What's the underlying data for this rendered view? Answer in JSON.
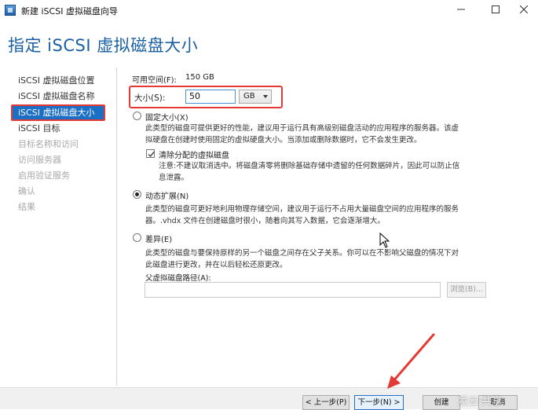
{
  "window": {
    "title": "新建 iSCSI 虚拟磁盘向导"
  },
  "page": {
    "title": "指定 iSCSI 虚拟磁盘大小"
  },
  "nav": {
    "items": [
      {
        "label": "iSCSI 虚拟磁盘位置",
        "state": "normal"
      },
      {
        "label": "iSCSI 虚拟磁盘名称",
        "state": "normal"
      },
      {
        "label": "iSCSI 虚拟磁盘大小",
        "state": "active"
      },
      {
        "label": "iSCSI 目标",
        "state": "normal"
      },
      {
        "label": "目标名称和访问",
        "state": "disabled"
      },
      {
        "label": "访问服务器",
        "state": "disabled"
      },
      {
        "label": "启用验证服务",
        "state": "disabled"
      },
      {
        "label": "确认",
        "state": "disabled"
      },
      {
        "label": "结果",
        "state": "disabled"
      }
    ]
  },
  "form": {
    "free_space_label": "可用空间(F):",
    "free_space_value": "150 GB",
    "size_label": "大小(S):",
    "size_value": "50",
    "unit_value": "GB",
    "fixed": {
      "label": "固定大小(X)",
      "desc_1": "此类型的磁盘可提供更好的性能，建议用于运行具有高级别磁盘活动的应用程序的服务器。该虚",
      "desc_2": "拟硬盘在创建时使用固定的虚拟硬盘大小。当添加或删除数据时，它不会发生更改。",
      "clear_label": "清除分配的虚拟磁盘",
      "clear_desc_1": "注意:不建议取消选中。将磁盘清零将删除基础存储中遗留的任何数据碎片，因此可以防止信",
      "clear_desc_2": "息泄露。"
    },
    "dynamic": {
      "label": "动态扩展(N)",
      "desc_1": "此类型的磁盘可更好地利用物理存储空间，建议用于运行不占用大量磁盘空间的应用程序的服务",
      "desc_2": "器。.vhdx 文件在创建磁盘时很小，随着向其写入数据，它会逐渐增大。"
    },
    "diff": {
      "label": "差异(E)",
      "desc_1": "此类型的磁盘与要保持原样的另一个磁盘之间存在父子关系。你可以在不影响父磁盘的情况下对",
      "desc_2": "此磁盘进行更改，并在以后轻松还原更改。",
      "parent_path_label": "父虚拟磁盘路径(A):",
      "parent_path_value": "",
      "browse_label": "浏览(B)..."
    },
    "selected_option": "dynamic"
  },
  "footer": {
    "prev_label": "< 上一步(P)",
    "next_label": "下一步(N) >",
    "create_label": "创建",
    "cancel_label": "取消"
  },
  "watermark": {
    "text": "凌云·共享"
  },
  "colors": {
    "title_blue": "#1a5fa3",
    "nav_active_bg": "#1b6fc4",
    "highlight_red": "#e53935"
  }
}
